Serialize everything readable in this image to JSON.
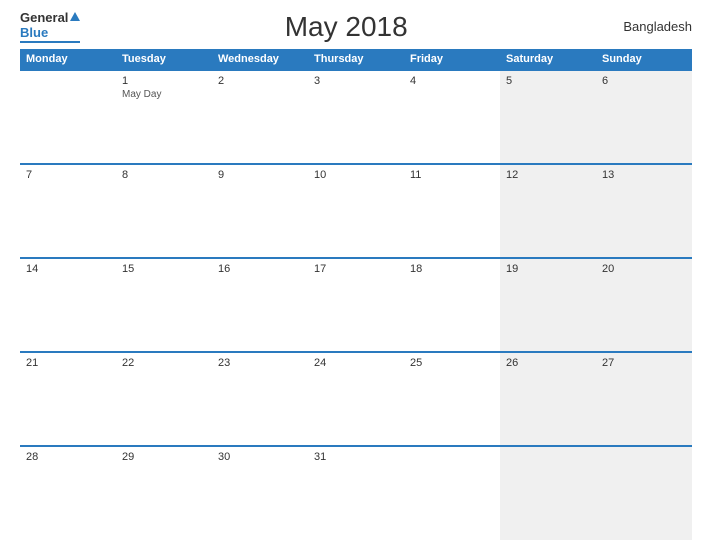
{
  "header": {
    "title": "May 2018",
    "country": "Bangladesh",
    "logo_general": "General",
    "logo_blue": "Blue"
  },
  "weekdays": [
    "Monday",
    "Tuesday",
    "Wednesday",
    "Thursday",
    "Friday",
    "Saturday",
    "Sunday"
  ],
  "weeks": [
    [
      {
        "day": "",
        "event": ""
      },
      {
        "day": "1",
        "event": "May Day"
      },
      {
        "day": "2",
        "event": ""
      },
      {
        "day": "3",
        "event": ""
      },
      {
        "day": "4",
        "event": ""
      },
      {
        "day": "5",
        "event": ""
      },
      {
        "day": "6",
        "event": ""
      }
    ],
    [
      {
        "day": "7",
        "event": ""
      },
      {
        "day": "8",
        "event": ""
      },
      {
        "day": "9",
        "event": ""
      },
      {
        "day": "10",
        "event": ""
      },
      {
        "day": "11",
        "event": ""
      },
      {
        "day": "12",
        "event": ""
      },
      {
        "day": "13",
        "event": ""
      }
    ],
    [
      {
        "day": "14",
        "event": ""
      },
      {
        "day": "15",
        "event": ""
      },
      {
        "day": "16",
        "event": ""
      },
      {
        "day": "17",
        "event": ""
      },
      {
        "day": "18",
        "event": ""
      },
      {
        "day": "19",
        "event": ""
      },
      {
        "day": "20",
        "event": ""
      }
    ],
    [
      {
        "day": "21",
        "event": ""
      },
      {
        "day": "22",
        "event": ""
      },
      {
        "day": "23",
        "event": ""
      },
      {
        "day": "24",
        "event": ""
      },
      {
        "day": "25",
        "event": ""
      },
      {
        "day": "26",
        "event": ""
      },
      {
        "day": "27",
        "event": ""
      }
    ],
    [
      {
        "day": "28",
        "event": ""
      },
      {
        "day": "29",
        "event": ""
      },
      {
        "day": "30",
        "event": ""
      },
      {
        "day": "31",
        "event": ""
      },
      {
        "day": "",
        "event": ""
      },
      {
        "day": "",
        "event": ""
      },
      {
        "day": "",
        "event": ""
      }
    ]
  ]
}
